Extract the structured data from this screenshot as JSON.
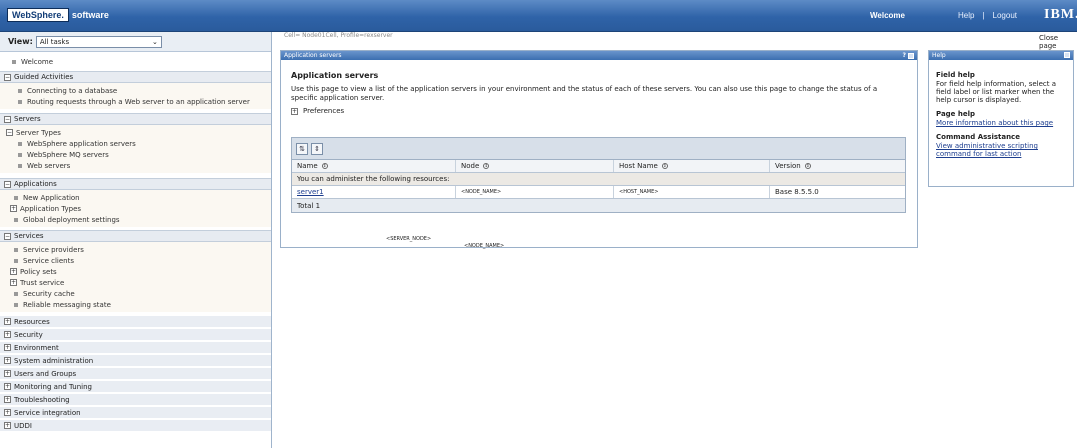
{
  "banner": {
    "logo_box": "WebSphere.",
    "logo_text": "software",
    "welcome": "Welcome",
    "help": "Help",
    "separator": "|",
    "logout": "Logout",
    "ibm": "IBM."
  },
  "nav": {
    "view_label": "View:",
    "view_value": "All tasks",
    "welcome": "Welcome",
    "guided": {
      "title": "Guided Activities",
      "items": [
        "Connecting to a database",
        "Routing requests through a Web server to an application server"
      ]
    },
    "servers": {
      "title": "Servers",
      "server_types": "Server Types",
      "items": [
        "WebSphere application servers",
        "WebSphere MQ servers",
        "Web servers"
      ]
    },
    "applications": {
      "title": "Applications",
      "new_app": "New Application",
      "app_types": "Application Types",
      "global": "Global deployment settings"
    },
    "services": {
      "title": "Services",
      "providers": "Service providers",
      "clients": "Service clients",
      "policy": "Policy sets",
      "trust": "Trust service",
      "cache": "Security cache",
      "reliable": "Reliable messaging state"
    },
    "collapsed": [
      "Resources",
      "Security",
      "Environment",
      "System administration",
      "Users and Groups",
      "Monitoring and Tuning",
      "Troubleshooting",
      "Service integration",
      "UDDI"
    ]
  },
  "main": {
    "cell_line": "Cell=          Node01Cell, Profile=rexserver",
    "portlet_title": "Application servers",
    "help_q": "?",
    "page_title": "Application servers",
    "description": "Use this page to view a list of the application servers in your environment and the status of each of these servers. You can also use this page to change the status of a specific application server.",
    "preferences": "Preferences",
    "table": {
      "headers": [
        "Name",
        "Node",
        "Host Name",
        "Version"
      ],
      "message": "You can administer the following resources:",
      "rows": [
        {
          "name": "server1",
          "node": "<NODE_NAME>",
          "host": "<HOST_NAME>",
          "version": "Base 8.5.5.0"
        }
      ],
      "total": "Total 1"
    },
    "floating_server_node": "<SERVER_NODE>",
    "floating_node_name": "<NODE_NAME>"
  },
  "help": {
    "close_page": "Close page",
    "title": "Help",
    "field_help_h": "Field help",
    "field_help": "For field help information, select a field label or list marker when the help cursor is displayed.",
    "page_help_h": "Page help",
    "page_help_link": "More information about this page",
    "cmd_h": "Command Assistance",
    "cmd_link": "View administrative scripting command for last action"
  }
}
